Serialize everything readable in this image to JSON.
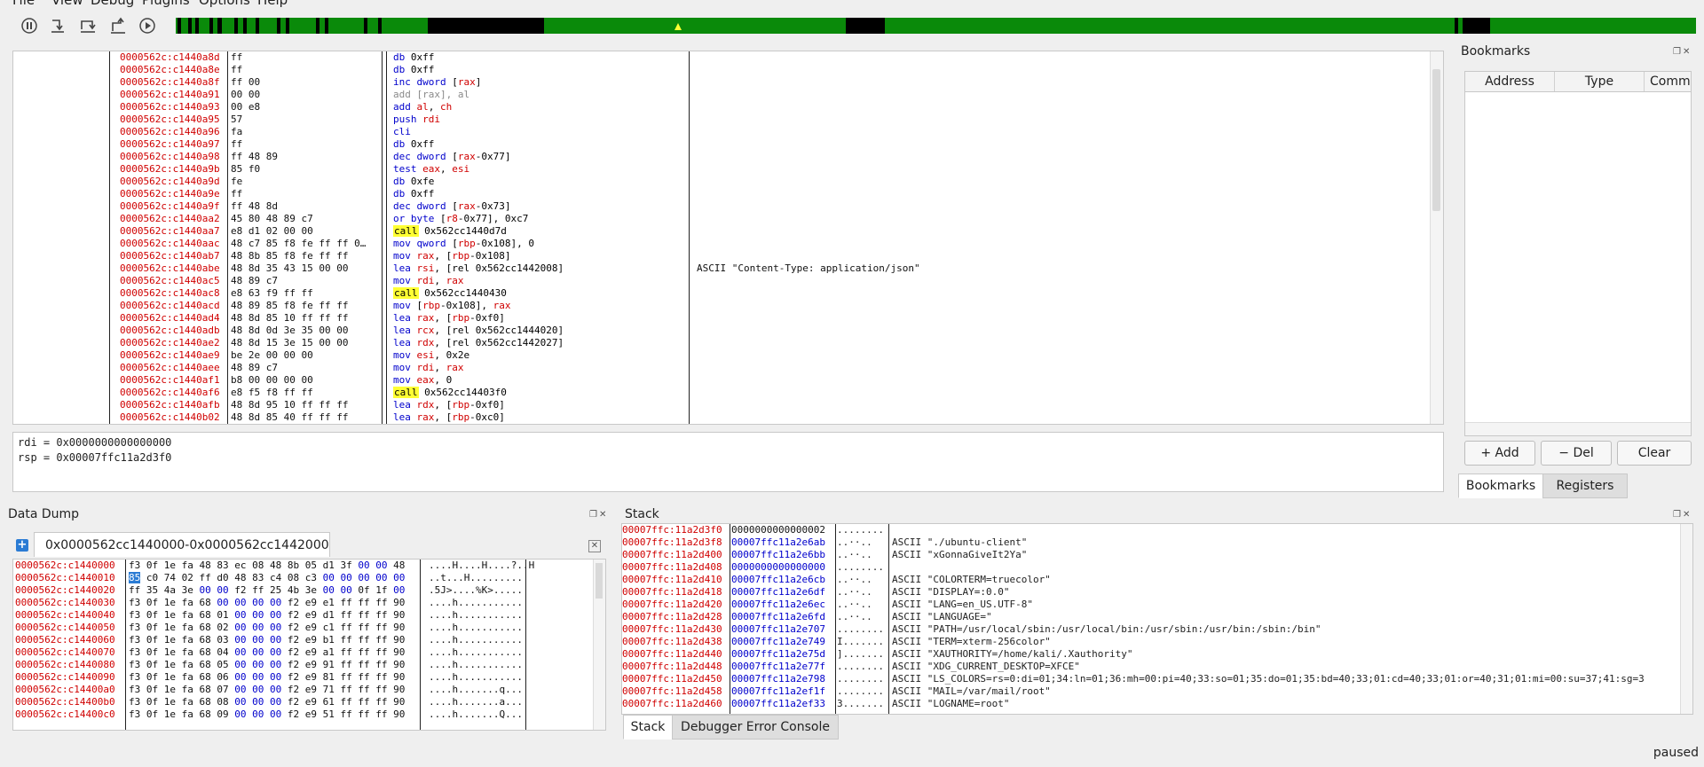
{
  "menu": [
    "File",
    "View",
    "Debug",
    "Plugins",
    "Options",
    "Help"
  ],
  "toolbar": {
    "buttons": [
      "pause-icon",
      "step-into-icon",
      "step-over-icon",
      "step-out-icon",
      "run-icon"
    ],
    "colors": {
      "mapped": "#0a8a0a",
      "unmapped": "#000000",
      "marker": "#ffff33"
    }
  },
  "disassembly": [
    {
      "addr": "0000562c:c1440a8d",
      "bytes": "ff",
      "ins": [
        [
          "mn",
          "db"
        ],
        [
          "imm",
          " 0xff"
        ]
      ]
    },
    {
      "addr": "0000562c:c1440a8e",
      "bytes": "ff",
      "ins": [
        [
          "mn",
          "db"
        ],
        [
          "imm",
          " 0xff"
        ]
      ]
    },
    {
      "addr": "0000562c:c1440a8f",
      "bytes": "ff 00",
      "ins": [
        [
          "mn",
          "inc dword"
        ],
        [
          "imm",
          " ["
        ],
        [
          "reg",
          "rax"
        ],
        [
          "imm",
          "]"
        ]
      ]
    },
    {
      "addr": "0000562c:c1440a91",
      "bytes": "00 00",
      "ins": [
        [
          "dis",
          "add [rax], al"
        ]
      ]
    },
    {
      "addr": "0000562c:c1440a93",
      "bytes": "00 e8",
      "ins": [
        [
          "mn",
          "add"
        ],
        [
          "reg",
          " al"
        ],
        [
          "imm",
          ", "
        ],
        [
          "reg",
          "ch"
        ]
      ]
    },
    {
      "addr": "0000562c:c1440a95",
      "bytes": "57",
      "ins": [
        [
          "mn",
          "push"
        ],
        [
          "reg",
          " rdi"
        ]
      ]
    },
    {
      "addr": "0000562c:c1440a96",
      "bytes": "fa",
      "ins": [
        [
          "mn",
          "cli"
        ]
      ]
    },
    {
      "addr": "0000562c:c1440a97",
      "bytes": "ff",
      "ins": [
        [
          "mn",
          "db"
        ],
        [
          "imm",
          " 0xff"
        ]
      ]
    },
    {
      "addr": "0000562c:c1440a98",
      "bytes": "ff 48 89",
      "ins": [
        [
          "mn",
          "dec dword"
        ],
        [
          "imm",
          " ["
        ],
        [
          "reg",
          "rax"
        ],
        [
          "imm",
          "-0x77]"
        ]
      ]
    },
    {
      "addr": "0000562c:c1440a9b",
      "bytes": "85 f0",
      "ins": [
        [
          "mn",
          "test"
        ],
        [
          "reg",
          " eax"
        ],
        [
          "imm",
          ", "
        ],
        [
          "reg",
          "esi"
        ]
      ]
    },
    {
      "addr": "0000562c:c1440a9d",
      "bytes": "fe",
      "ins": [
        [
          "mn",
          "db"
        ],
        [
          "imm",
          " 0xfe"
        ]
      ]
    },
    {
      "addr": "0000562c:c1440a9e",
      "bytes": "ff",
      "ins": [
        [
          "mn",
          "db"
        ],
        [
          "imm",
          " 0xff"
        ]
      ]
    },
    {
      "addr": "0000562c:c1440a9f",
      "bytes": "ff 48 8d",
      "ins": [
        [
          "mn",
          "dec dword"
        ],
        [
          "imm",
          " ["
        ],
        [
          "reg",
          "rax"
        ],
        [
          "imm",
          "-0x73]"
        ]
      ]
    },
    {
      "addr": "0000562c:c1440aa2",
      "bytes": "45 80 48 89 c7",
      "ins": [
        [
          "mn",
          "or byte"
        ],
        [
          "imm",
          " ["
        ],
        [
          "reg",
          "r8"
        ],
        [
          "imm",
          "-0x77], 0xc7"
        ]
      ]
    },
    {
      "addr": "0000562c:c1440aa7",
      "bytes": "e8 d1 02 00 00",
      "ins": [
        [
          "call",
          "call"
        ],
        [
          "imm",
          " 0x562cc1440d7d"
        ]
      ]
    },
    {
      "addr": "0000562c:c1440aac",
      "bytes": "48 c7 85 f8 fe ff ff 0…",
      "ins": [
        [
          "mn",
          "mov qword"
        ],
        [
          "imm",
          " ["
        ],
        [
          "reg",
          "rbp"
        ],
        [
          "imm",
          "-0x108], 0"
        ]
      ]
    },
    {
      "addr": "0000562c:c1440ab7",
      "bytes": "48 8b 85 f8 fe ff ff",
      "ins": [
        [
          "mn",
          "mov"
        ],
        [
          "reg",
          " rax"
        ],
        [
          "imm",
          ", ["
        ],
        [
          "reg",
          "rbp"
        ],
        [
          "imm",
          "-0x108]"
        ]
      ]
    },
    {
      "addr": "0000562c:c1440abe",
      "bytes": "48 8d 35 43 15 00 00",
      "ins": [
        [
          "mn",
          "lea"
        ],
        [
          "reg",
          " rsi"
        ],
        [
          "imm",
          ", [rel 0x562cc1442008]"
        ]
      ],
      "cmt": "ASCII \"Content-Type: application/json\""
    },
    {
      "addr": "0000562c:c1440ac5",
      "bytes": "48 89 c7",
      "ins": [
        [
          "mn",
          "mov"
        ],
        [
          "reg",
          " rdi"
        ],
        [
          "imm",
          ", "
        ],
        [
          "reg",
          "rax"
        ]
      ]
    },
    {
      "addr": "0000562c:c1440ac8",
      "bytes": "e8 63 f9 ff ff",
      "ins": [
        [
          "call",
          "call"
        ],
        [
          "imm",
          " 0x562cc1440430"
        ]
      ]
    },
    {
      "addr": "0000562c:c1440acd",
      "bytes": "48 89 85 f8 fe ff ff",
      "ins": [
        [
          "mn",
          "mov"
        ],
        [
          "imm",
          " ["
        ],
        [
          "reg",
          "rbp"
        ],
        [
          "imm",
          "-0x108], "
        ],
        [
          "reg",
          "rax"
        ]
      ]
    },
    {
      "addr": "0000562c:c1440ad4",
      "bytes": "48 8d 85 10 ff ff ff",
      "ins": [
        [
          "mn",
          "lea"
        ],
        [
          "reg",
          " rax"
        ],
        [
          "imm",
          ", ["
        ],
        [
          "reg",
          "rbp"
        ],
        [
          "imm",
          "-0xf0]"
        ]
      ]
    },
    {
      "addr": "0000562c:c1440adb",
      "bytes": "48 8d 0d 3e 35 00 00",
      "ins": [
        [
          "mn",
          "lea"
        ],
        [
          "reg",
          " rcx"
        ],
        [
          "imm",
          ", [rel 0x562cc1444020]"
        ]
      ]
    },
    {
      "addr": "0000562c:c1440ae2",
      "bytes": "48 8d 15 3e 15 00 00",
      "ins": [
        [
          "mn",
          "lea"
        ],
        [
          "reg",
          " rdx"
        ],
        [
          "imm",
          ", [rel 0x562cc1442027]"
        ]
      ]
    },
    {
      "addr": "0000562c:c1440ae9",
      "bytes": "be 2e 00 00 00",
      "ins": [
        [
          "mn",
          "mov"
        ],
        [
          "reg",
          " esi"
        ],
        [
          "imm",
          ", 0x2e"
        ]
      ]
    },
    {
      "addr": "0000562c:c1440aee",
      "bytes": "48 89 c7",
      "ins": [
        [
          "mn",
          "mov"
        ],
        [
          "reg",
          " rdi"
        ],
        [
          "imm",
          ", "
        ],
        [
          "reg",
          "rax"
        ]
      ]
    },
    {
      "addr": "0000562c:c1440af1",
      "bytes": "b8 00 00 00 00",
      "ins": [
        [
          "mn",
          "mov"
        ],
        [
          "reg",
          " eax"
        ],
        [
          "imm",
          ", 0"
        ]
      ]
    },
    {
      "addr": "0000562c:c1440af6",
      "bytes": "e8 f5 f8 ff ff",
      "ins": [
        [
          "call",
          "call"
        ],
        [
          "imm",
          " 0x562cc14403f0"
        ]
      ]
    },
    {
      "addr": "0000562c:c1440afb",
      "bytes": "48 8d 95 10 ff ff ff",
      "ins": [
        [
          "mn",
          "lea"
        ],
        [
          "reg",
          " rdx"
        ],
        [
          "imm",
          ", ["
        ],
        [
          "reg",
          "rbp"
        ],
        [
          "imm",
          "-0xf0]"
        ]
      ]
    },
    {
      "addr": "0000562c:c1440b02",
      "bytes": "48 8d 85 40 ff ff ff",
      "ins": [
        [
          "mn",
          "lea"
        ],
        [
          "reg",
          " rax"
        ],
        [
          "imm",
          ", ["
        ],
        [
          "reg",
          "rbp"
        ],
        [
          "imm",
          "-0xc0]"
        ]
      ]
    }
  ],
  "register_preview": [
    "rdi = 0x0000000000000000",
    "rsp = 0x00007ffc11a2d3f0"
  ],
  "bookmarks": {
    "title": "Bookmarks",
    "columns": [
      "Address",
      "Type",
      "Comment"
    ],
    "add_label": "+ Add",
    "del_label": "− Del",
    "clear_label": "Clear",
    "tabs": [
      "Bookmarks",
      "Registers"
    ]
  },
  "data_dump": {
    "title": "Data Dump",
    "tab_label": "0x0000562cc1440000-0x0000562cc1442000",
    "rows": [
      {
        "addr": "0000562c:c1440000",
        "hex": [
          "f3",
          "0f",
          "1e",
          "fa",
          "48",
          "83",
          "ec",
          "08",
          "48",
          "8b",
          "05",
          "d1",
          "3f",
          "00",
          "00",
          "48"
        ],
        "ascii": "....H....H....?..H"
      },
      {
        "addr": "0000562c:c1440010",
        "hex": [
          "85",
          "c0",
          "74",
          "02",
          "ff",
          "d0",
          "48",
          "83",
          "c4",
          "08",
          "c3",
          "00",
          "00",
          "00",
          "00",
          "00"
        ],
        "ascii": "..t...H........."
      },
      {
        "addr": "0000562c:c1440020",
        "hex": [
          "ff",
          "35",
          "4a",
          "3e",
          "00",
          "00",
          "f2",
          "ff",
          "25",
          "4b",
          "3e",
          "00",
          "00",
          "0f",
          "1f",
          "00"
        ],
        "ascii": ".5J>....%K>....."
      },
      {
        "addr": "0000562c:c1440030",
        "hex": [
          "f3",
          "0f",
          "1e",
          "fa",
          "68",
          "00",
          "00",
          "00",
          "00",
          "f2",
          "e9",
          "e1",
          "ff",
          "ff",
          "ff",
          "90"
        ],
        "ascii": "....h..........."
      },
      {
        "addr": "0000562c:c1440040",
        "hex": [
          "f3",
          "0f",
          "1e",
          "fa",
          "68",
          "01",
          "00",
          "00",
          "00",
          "f2",
          "e9",
          "d1",
          "ff",
          "ff",
          "ff",
          "90"
        ],
        "ascii": "....h..........."
      },
      {
        "addr": "0000562c:c1440050",
        "hex": [
          "f3",
          "0f",
          "1e",
          "fa",
          "68",
          "02",
          "00",
          "00",
          "00",
          "f2",
          "e9",
          "c1",
          "ff",
          "ff",
          "ff",
          "90"
        ],
        "ascii": "....h..........."
      },
      {
        "addr": "0000562c:c1440060",
        "hex": [
          "f3",
          "0f",
          "1e",
          "fa",
          "68",
          "03",
          "00",
          "00",
          "00",
          "f2",
          "e9",
          "b1",
          "ff",
          "ff",
          "ff",
          "90"
        ],
        "ascii": "....h..........."
      },
      {
        "addr": "0000562c:c1440070",
        "hex": [
          "f3",
          "0f",
          "1e",
          "fa",
          "68",
          "04",
          "00",
          "00",
          "00",
          "f2",
          "e9",
          "a1",
          "ff",
          "ff",
          "ff",
          "90"
        ],
        "ascii": "....h..........."
      },
      {
        "addr": "0000562c:c1440080",
        "hex": [
          "f3",
          "0f",
          "1e",
          "fa",
          "68",
          "05",
          "00",
          "00",
          "00",
          "f2",
          "e9",
          "91",
          "ff",
          "ff",
          "ff",
          "90"
        ],
        "ascii": "....h..........."
      },
      {
        "addr": "0000562c:c1440090",
        "hex": [
          "f3",
          "0f",
          "1e",
          "fa",
          "68",
          "06",
          "00",
          "00",
          "00",
          "f2",
          "e9",
          "81",
          "ff",
          "ff",
          "ff",
          "90"
        ],
        "ascii": "....h..........."
      },
      {
        "addr": "0000562c:c14400a0",
        "hex": [
          "f3",
          "0f",
          "1e",
          "fa",
          "68",
          "07",
          "00",
          "00",
          "00",
          "f2",
          "e9",
          "71",
          "ff",
          "ff",
          "ff",
          "90"
        ],
        "ascii": "....h.......q..."
      },
      {
        "addr": "0000562c:c14400b0",
        "hex": [
          "f3",
          "0f",
          "1e",
          "fa",
          "68",
          "08",
          "00",
          "00",
          "00",
          "f2",
          "e9",
          "61",
          "ff",
          "ff",
          "ff",
          "90"
        ],
        "ascii": "....h.......a..."
      },
      {
        "addr": "0000562c:c14400c0",
        "hex": [
          "f3",
          "0f",
          "1e",
          "fa",
          "68",
          "09",
          "00",
          "00",
          "00",
          "f2",
          "e9",
          "51",
          "ff",
          "ff",
          "ff",
          "90"
        ],
        "ascii": "....h.......Q..."
      }
    ]
  },
  "stack": {
    "title": "Stack",
    "rows": [
      {
        "addr": "00007ffc:11a2d3f0",
        "val": "0000000000000002",
        "ptr": false,
        "asc": "........",
        "cmt": ""
      },
      {
        "addr": "00007ffc:11a2d3f8",
        "val": "00007ffc11a2e6ab",
        "ptr": true,
        "asc": "..··..",
        "cmt": "ASCII \"./ubuntu-client\""
      },
      {
        "addr": "00007ffc:11a2d400",
        "val": "00007ffc11a2e6bb",
        "ptr": true,
        "asc": "..··..",
        "cmt": "ASCII \"xGonnaGiveIt2Ya\""
      },
      {
        "addr": "00007ffc:11a2d408",
        "val": "0000000000000000",
        "ptr": true,
        "asc": "........",
        "cmt": ""
      },
      {
        "addr": "00007ffc:11a2d410",
        "val": "00007ffc11a2e6cb",
        "ptr": true,
        "asc": "..··..",
        "cmt": "ASCII \"COLORTERM=truecolor\""
      },
      {
        "addr": "00007ffc:11a2d418",
        "val": "00007ffc11a2e6df",
        "ptr": true,
        "asc": "..··..",
        "cmt": "ASCII \"DISPLAY=:0.0\""
      },
      {
        "addr": "00007ffc:11a2d420",
        "val": "00007ffc11a2e6ec",
        "ptr": true,
        "asc": "..··..",
        "cmt": "ASCII \"LANG=en_US.UTF-8\""
      },
      {
        "addr": "00007ffc:11a2d428",
        "val": "00007ffc11a2e6fd",
        "ptr": true,
        "asc": "..··..",
        "cmt": "ASCII \"LANGUAGE=\""
      },
      {
        "addr": "00007ffc:11a2d430",
        "val": "00007ffc11a2e707",
        "ptr": true,
        "asc": "........",
        "cmt": "ASCII \"PATH=/usr/local/sbin:/usr/local/bin:/usr/sbin:/usr/bin:/sbin:/bin\""
      },
      {
        "addr": "00007ffc:11a2d438",
        "val": "00007ffc11a2e749",
        "ptr": true,
        "asc": "I.......",
        "cmt": "ASCII \"TERM=xterm-256color\""
      },
      {
        "addr": "00007ffc:11a2d440",
        "val": "00007ffc11a2e75d",
        "ptr": true,
        "asc": "].......",
        "cmt": "ASCII \"XAUTHORITY=/home/kali/.Xauthority\""
      },
      {
        "addr": "00007ffc:11a2d448",
        "val": "00007ffc11a2e77f",
        "ptr": true,
        "asc": "........",
        "cmt": "ASCII \"XDG_CURRENT_DESKTOP=XFCE\""
      },
      {
        "addr": "00007ffc:11a2d450",
        "val": "00007ffc11a2e798",
        "ptr": true,
        "asc": "........",
        "cmt": "ASCII \"LS_COLORS=rs=0:di=01;34:ln=01;36:mh=00:pi=40;33:so=01;35:do=01;35:bd=40;33;01:cd=40;33;01:or=40;31;01:mi=00:su=37;41:sg=3"
      },
      {
        "addr": "00007ffc:11a2d458",
        "val": "00007ffc11a2ef1f",
        "ptr": true,
        "asc": "........",
        "cmt": "ASCII \"MAIL=/var/mail/root\""
      },
      {
        "addr": "00007ffc:11a2d460",
        "val": "00007ffc11a2ef33",
        "ptr": true,
        "asc": "3.......",
        "cmt": "ASCII \"LOGNAME=root\""
      }
    ],
    "tabs": [
      "Stack",
      "Debugger Error Console"
    ]
  },
  "status": "paused"
}
